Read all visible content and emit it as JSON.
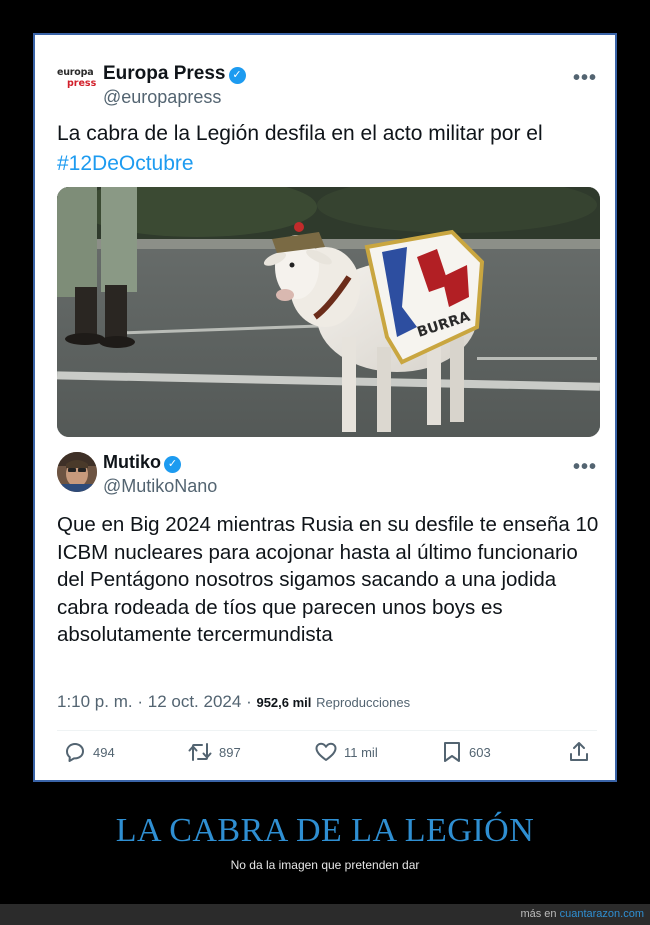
{
  "quoted_tweet": {
    "source_logo": {
      "line1": "europa",
      "line2": "press"
    },
    "display_name": "Europa Press",
    "handle": "@europapress",
    "text": "La cabra de la Legión desfila en el acto militar por el ",
    "hashtag": "#12DeOctubre",
    "more_icon": "more-horizontal-icon",
    "media": {
      "banner_text": "BURRA"
    }
  },
  "reply_tweet": {
    "display_name": "Mutiko",
    "handle": "@MutikoNano",
    "text": "Que en Big 2024 mientras Rusia en su desfile te enseña 10 ICBM nucleares para acojonar hasta al último funcionario del Pentágono nosotros sigamos sacando a una jodida cabra rodeada de tíos que parecen unos boys es absolutamente tercermundista",
    "time": "1:10 p. m.",
    "sep1": "·",
    "date": "12 oct. 2024",
    "sep2": "·",
    "views_count": "952,6 mil",
    "views_label": "Reproducciones"
  },
  "actions": {
    "replies": "494",
    "retweets": "897",
    "likes": "11 mil",
    "bookmarks": "603"
  },
  "caption": {
    "title": "LA CABRA DE LA LEGIÓN",
    "subtitle": "No da la imagen que pretenden dar"
  },
  "footer": {
    "prefix": "más en ",
    "link": "cuantarazon.com"
  },
  "colors": {
    "accent_blue": "#1d9bf0",
    "caption_blue": "#2f8fd2",
    "frame_border": "#3a64a8",
    "logo_red": "#d21f2a"
  }
}
